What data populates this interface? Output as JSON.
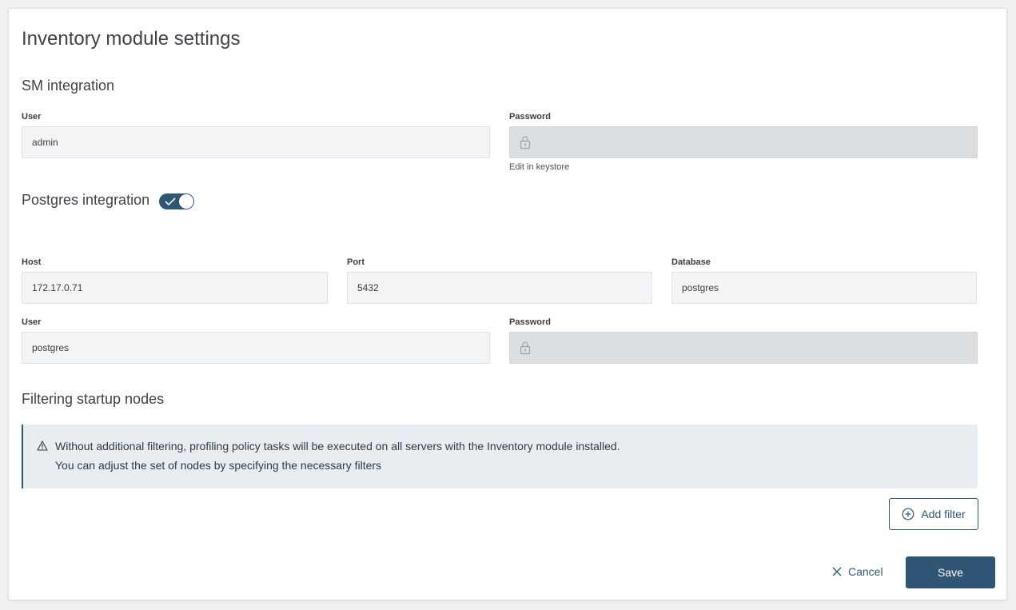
{
  "page": {
    "title": "Inventory module settings"
  },
  "sm_integration": {
    "title": "SM integration",
    "user_label": "User",
    "user_value": "admin",
    "password_label": "Password",
    "password_hint": "Edit in keystore"
  },
  "postgres_integration": {
    "title": "Postgres integration",
    "enabled": true,
    "host_label": "Host",
    "host_value": "172.17.0.71",
    "port_label": "Port",
    "port_value": "5432",
    "database_label": "Database",
    "database_value": "postgres",
    "user_label": "User",
    "user_value": "postgres",
    "password_label": "Password"
  },
  "filtering": {
    "title": "Filtering startup nodes",
    "info_line_1": "Without additional filtering, profiling policy tasks will be executed on all servers with the Inventory module installed.",
    "info_line_2": "You can adjust the set of nodes by specifying the necessary filters",
    "add_filter_label": "Add filter"
  },
  "footer": {
    "cancel_label": "Cancel",
    "save_label": "Save"
  },
  "colors": {
    "accent": "#2f5675",
    "info_background": "#e8edf1",
    "locked_input": "#dcdfe2"
  },
  "icons": [
    "lock-icon",
    "check-icon",
    "warning-icon",
    "plus-circle-icon",
    "close-icon"
  ]
}
